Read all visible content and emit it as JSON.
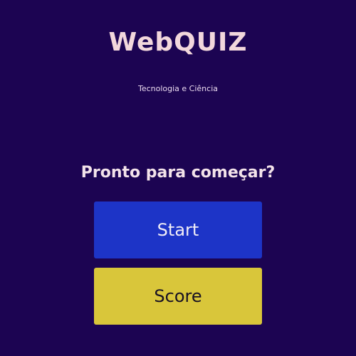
{
  "app": {
    "title": "WebQUIZ",
    "subtitle": "Tecnologia e Ciência"
  },
  "main": {
    "prompt": "Pronto para começar?",
    "start_label": "Start",
    "score_label": "Score"
  },
  "colors": {
    "background": "#1c0452",
    "start_button": "#1d34c7",
    "score_button": "#d9c63a",
    "title_text": "#f2d7dc"
  }
}
